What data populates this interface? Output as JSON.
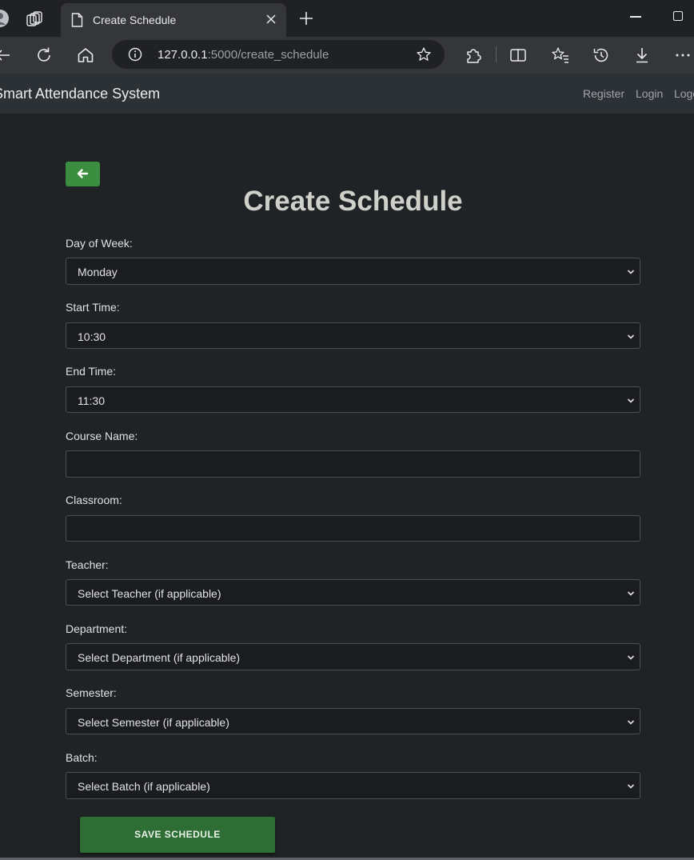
{
  "browser": {
    "tab_title": "Create Schedule",
    "url_host": "127.0.0.1",
    "url_path": ":5000/create_schedule"
  },
  "navbar": {
    "brand": "Smart Attendance System",
    "links": [
      "Register",
      "Login",
      "Logout"
    ]
  },
  "page": {
    "title": "Create Schedule",
    "save_label": "SAVE SCHEDULE"
  },
  "form": {
    "day": {
      "label": "Day of Week:",
      "value": "Monday"
    },
    "start": {
      "label": "Start Time:",
      "value": "10:30"
    },
    "end": {
      "label": "End Time:",
      "value": "11:30"
    },
    "course": {
      "label": "Course Name:",
      "value": ""
    },
    "classroom": {
      "label": "Classroom:",
      "value": ""
    },
    "teacher": {
      "label": "Teacher:",
      "value": "Select Teacher (if applicable)"
    },
    "department": {
      "label": "Department:",
      "value": "Select Department (if applicable)"
    },
    "semester": {
      "label": "Semester:",
      "value": "Select Semester (if applicable)"
    },
    "batch": {
      "label": "Batch:",
      "value": "Select Batch (if applicable)"
    }
  },
  "colors": {
    "accent_green": "#3b8d3f",
    "save_green": "#2e6d33",
    "page_bg": "#1f2325"
  }
}
